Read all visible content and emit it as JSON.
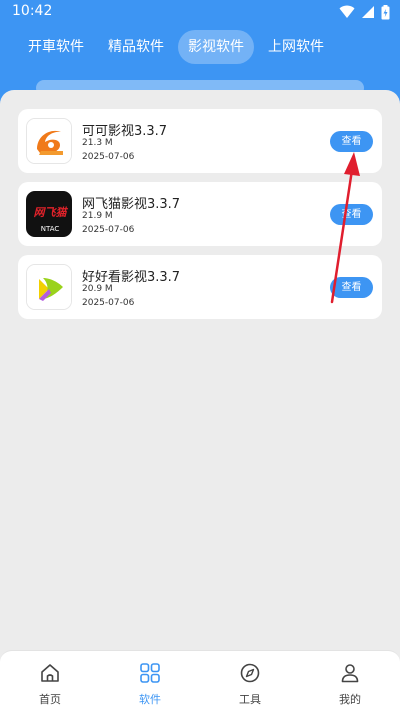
{
  "status": {
    "time": "10:42"
  },
  "tabs": [
    {
      "label": "开車软件"
    },
    {
      "label": "精品软件"
    },
    {
      "label": "影视软件"
    },
    {
      "label": "上网软件"
    }
  ],
  "apps": [
    {
      "name": "可可影视3.3.7",
      "size": "21.3 M",
      "date": "2025-07-06",
      "button": "查看",
      "icon": "keke-logo-icon"
    },
    {
      "name": "网飞猫影视3.3.7",
      "size": "21.9 M",
      "date": "2025-07-06",
      "button": "查看",
      "icon": "wangfeimao-logo-icon",
      "icon_text": "网飞猫",
      "icon_sub": "NTAC"
    },
    {
      "name": "好好看影视3.3.7",
      "size": "20.9 M",
      "date": "2025-07-06",
      "button": "查看",
      "icon": "haohaokan-logo-icon"
    }
  ],
  "nav": [
    {
      "label": "首页",
      "icon": "home-icon"
    },
    {
      "label": "软件",
      "icon": "apps-grid-icon"
    },
    {
      "label": "工具",
      "icon": "compass-icon"
    },
    {
      "label": "我的",
      "icon": "user-icon"
    }
  ],
  "colors": {
    "accent": "#3d95f3",
    "annotation_arrow": "#e01e2e"
  }
}
